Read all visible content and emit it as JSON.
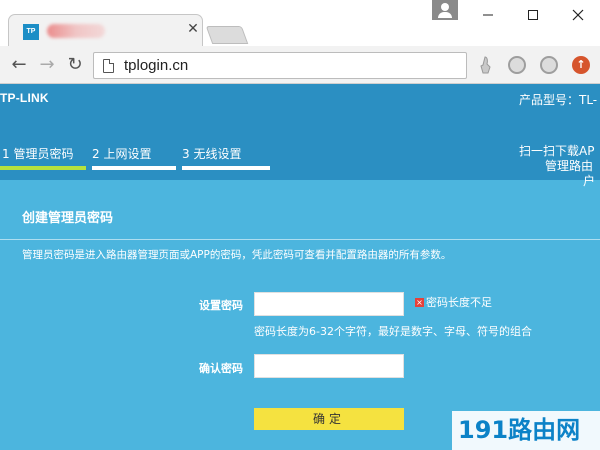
{
  "browser": {
    "tab": {
      "favicon_text": "TP"
    },
    "window_controls": {
      "minimize": "—",
      "maximize": "☐",
      "close": "✕"
    },
    "nav": {
      "back": "←",
      "forward": "→",
      "reload": "↻"
    },
    "url": "tplogin.cn"
  },
  "header": {
    "logo": "TP-LINK",
    "model_label": "产品型号：TL-",
    "qr_line1": "扫一扫下载AP",
    "qr_line2": "管理路由",
    "qr_line3": "户"
  },
  "steps": [
    {
      "label": "1 管理员密码",
      "active": true
    },
    {
      "label": "2 上网设置",
      "active": false
    },
    {
      "label": "3 无线设置",
      "active": false
    }
  ],
  "form": {
    "title": "创建管理员密码",
    "description": "管理员密码是进入路由器管理页面或APP的密码，凭此密码可查看并配置路由器的所有参数。",
    "password_label": "设置密码",
    "password_value": "",
    "error_icon": "×",
    "error_text": "密码长度不足",
    "hint": "密码长度为6-32个字符，最好是数字、字母、符号的组合",
    "confirm_label": "确认密码",
    "confirm_value": "",
    "submit_label": "确定"
  },
  "watermark": "191路由网",
  "colors": {
    "header_bg": "#2b8fc2",
    "body_bg": "#4cb5de",
    "active_step": "#b6e23f",
    "button": "#f5e240",
    "error": "#e5413b"
  }
}
